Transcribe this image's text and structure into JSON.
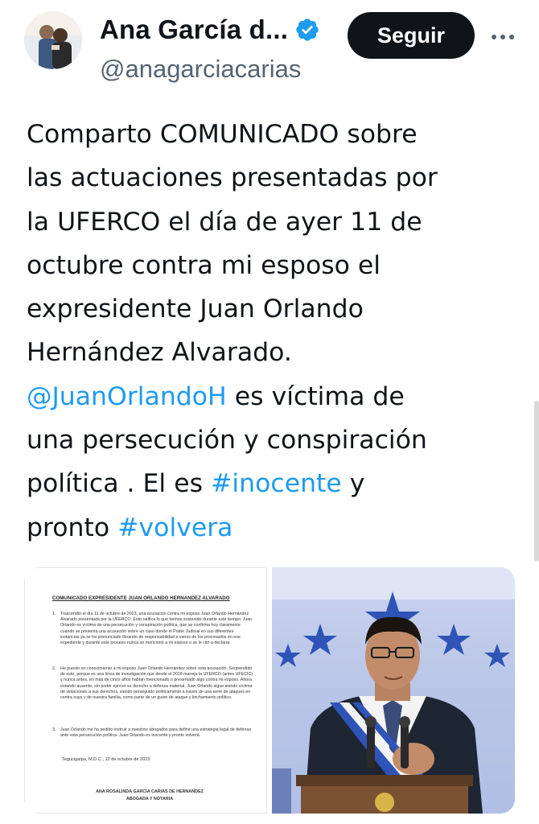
{
  "profile": {
    "name": "Ana García d...",
    "handle": "@anagarciacarias",
    "verified": true,
    "follow_label": "Seguir"
  },
  "tweet": {
    "lines": [
      [
        {
          "t": "Comparto COMUNICADO sobre"
        }
      ],
      [
        {
          "t": "las actuaciones presentadas por"
        }
      ],
      [
        {
          "t": "la UFERCO el día de ayer  11 de"
        }
      ],
      [
        {
          "t": "octubre contra mi esposo el"
        }
      ],
      [
        {
          "t": "expresidente Juan Orlando"
        }
      ],
      [
        {
          "t": "Hernández Alvarado."
        }
      ],
      [
        {
          "t": "@JuanOrlandoH",
          "link": true
        },
        {
          "t": "  es víctima de"
        }
      ],
      [
        {
          "t": "una persecución y conspiración"
        }
      ],
      [
        {
          "t": "política . El es "
        },
        {
          "t": "#inocente",
          "link": true
        },
        {
          "t": " y"
        }
      ],
      [
        {
          "t": "pronto "
        },
        {
          "t": "#volvera",
          "link": true
        }
      ]
    ]
  },
  "document": {
    "title": "COMUNICADO EXPRESIDENTE JUAN ORLANDO HERNANDEZ ALVARADO",
    "paragraphs": [
      {
        "num": "1.",
        "text": "Trascendió el día 11 de octubre de 2023, una acusación contra mi esposo Juan Orlando Hernández Alvarado presentada por la UFERCO. Esto ratifica lo que hemos sostenido durante este tiempo; Juan Orlando es víctima de una persecución y conspiración política, que se confirma hoy claramente cuando se presenta una acusación sobre un caso donde el Poder Judicial en sus diferentes instancias ya se ha pronunciado librando de responsabilidad a varios de los procesados en ese expediente y durante este proceso nunca se mencionó a mi esposo o se le citó a declarar."
      },
      {
        "num": "2.",
        "text": "He puesto en conocimiento a mi esposo Juan Orlando Hernández sobre esta acusación. Sorprendido de esto, porque es una línea de investigación que desde el 2018 maneja la UFERCO (antes UFECIC) y nunca antes, en más de cinco años habían mencionado o presentado algo contra mi esposo. Ahora estando ausente, sin poder ejercer su derecho a defensa material, Juan Orlando sigue siendo víctima de violaciones a sus derechos, siendo perseguido políticamente a través de una serie de ataques en contra suya y de nuestra familia, como parte de un guion de ataque y linchamiento político."
      },
      {
        "num": "3.",
        "text": "Juan Orlando me ha pedido instruir a nuestros abogados para definir una estrategia legal de defensa ante esta persecución política. Juan Orlando es inocente y pronto volverá."
      }
    ],
    "date": "Tegucigalpa, M.D.C., 12 de octubre de 2023",
    "signature_name": "ANA ROSALINDA GARCIA CARIAS DE HERNANDEZ",
    "signature_title": "ABOGADA Y NOTARIA"
  },
  "colors": {
    "link": "#1d9bf0",
    "verified": "#1d9bf0",
    "secondary_text": "#536471",
    "primary_text": "#0f1419"
  },
  "icons": {
    "verified": "verified-badge-icon",
    "more": "more-options-icon"
  }
}
